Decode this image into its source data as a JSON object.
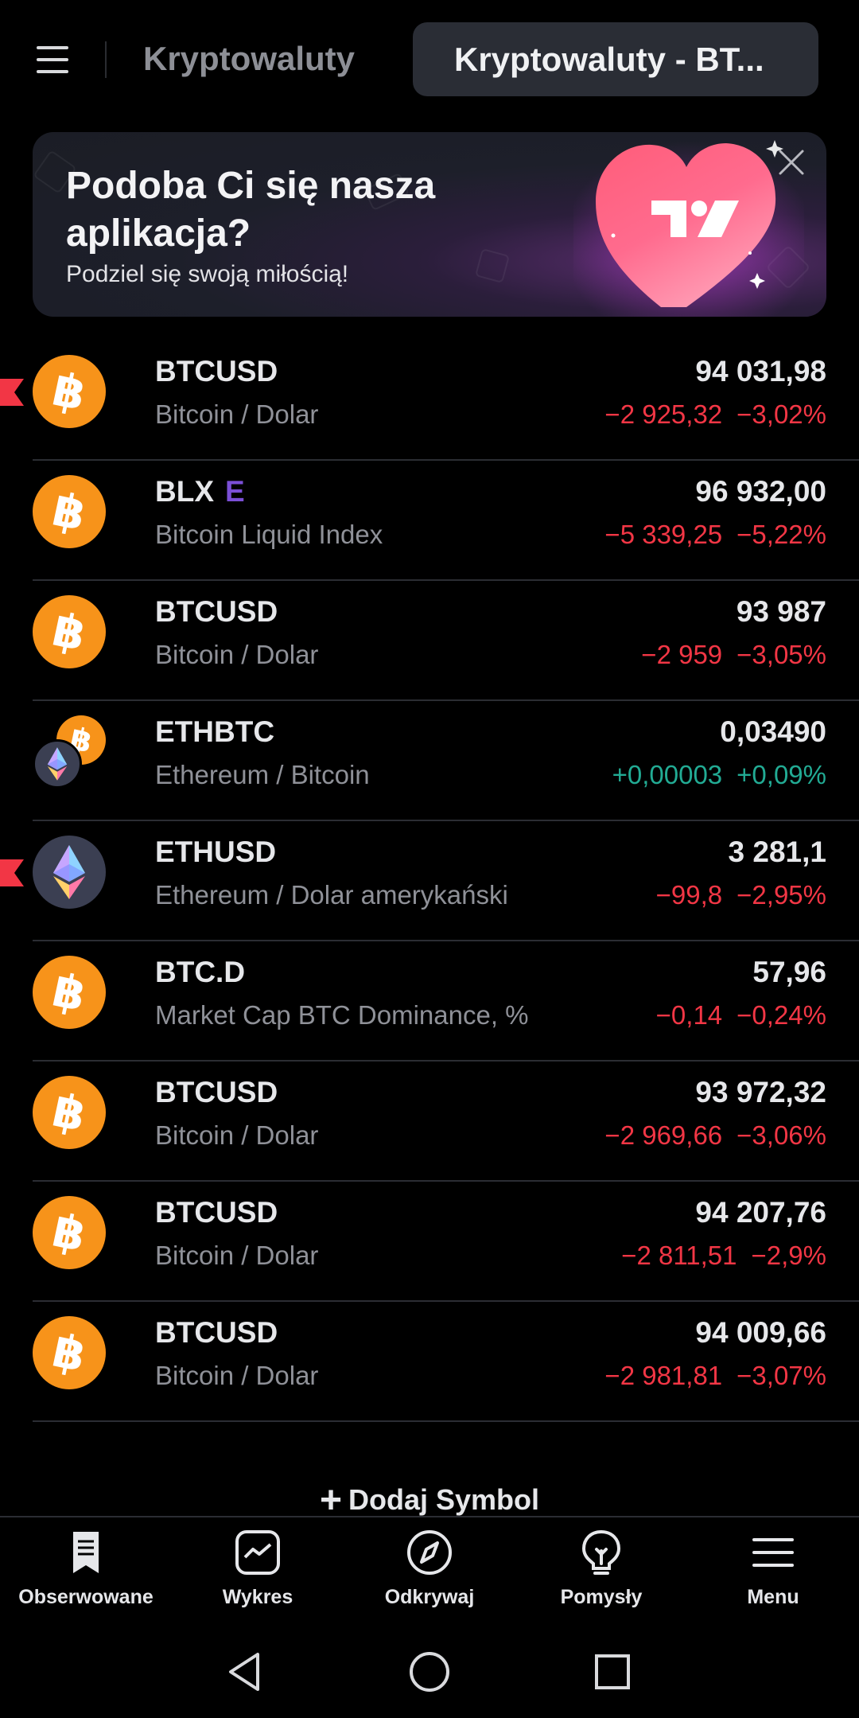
{
  "header": {
    "tab_label": "Kryptowaluty",
    "active_tab_label": "Kryptowaluty - BT..."
  },
  "banner": {
    "title": "Podoba Ci się nasza aplikacja?",
    "subtitle": "Podziel się swoją miłością!"
  },
  "rows": [
    {
      "symbol": "BTCUSD",
      "badge": "",
      "description": "Bitcoin / Dolar",
      "price": "94 031,98",
      "change": "−2 925,32",
      "change_pct": "−3,02%",
      "direction": "down",
      "icon": "bitcoin-icon",
      "flagged": true
    },
    {
      "symbol": "BLX",
      "badge": "E",
      "description": "Bitcoin Liquid Index",
      "price": "96 932,00",
      "change": "−5 339,25",
      "change_pct": "−5,22%",
      "direction": "down",
      "icon": "bitcoin-icon",
      "flagged": false
    },
    {
      "symbol": "BTCUSD",
      "badge": "",
      "description": "Bitcoin / Dolar",
      "price": "93 987",
      "change": "−2 959",
      "change_pct": "−3,05%",
      "direction": "down",
      "icon": "bitcoin-icon",
      "flagged": false
    },
    {
      "symbol": "ETHBTC",
      "badge": "",
      "description": "Ethereum / Bitcoin",
      "price": "0,03490",
      "change": "+0,00003",
      "change_pct": "+0,09%",
      "direction": "up",
      "icon": "ethereum-bitcoin-icon",
      "flagged": false
    },
    {
      "symbol": "ETHUSD",
      "badge": "",
      "description": "Ethereum / Dolar amerykański",
      "price": "3 281,1",
      "change": "−99,8",
      "change_pct": "−2,95%",
      "direction": "down",
      "icon": "ethereum-icon",
      "flagged": true
    },
    {
      "symbol": "BTC.D",
      "badge": "",
      "description": "Market Cap BTC Dominance, %",
      "price": "57,96",
      "change": "−0,14",
      "change_pct": "−0,24%",
      "direction": "down",
      "icon": "bitcoin-icon",
      "flagged": false
    },
    {
      "symbol": "BTCUSD",
      "badge": "",
      "description": "Bitcoin / Dolar",
      "price": "93 972,32",
      "change": "−2 969,66",
      "change_pct": "−3,06%",
      "direction": "down",
      "icon": "bitcoin-icon",
      "flagged": false
    },
    {
      "symbol": "BTCUSD",
      "badge": "",
      "description": "Bitcoin / Dolar",
      "price": "94 207,76",
      "change": "−2 811,51",
      "change_pct": "−2,9%",
      "direction": "down",
      "icon": "bitcoin-icon",
      "flagged": false
    },
    {
      "symbol": "BTCUSD",
      "badge": "",
      "description": "Bitcoin / Dolar",
      "price": "94 009,66",
      "change": "−2 981,81",
      "change_pct": "−3,07%",
      "direction": "down",
      "icon": "bitcoin-icon",
      "flagged": false
    }
  ],
  "add_symbol_label": "Dodaj Symbol",
  "bottom_nav": [
    {
      "label": "Obserwowane",
      "icon": "bookmark-list-icon"
    },
    {
      "label": "Wykres",
      "icon": "chart-icon"
    },
    {
      "label": "Odkrywaj",
      "icon": "compass-icon"
    },
    {
      "label": "Pomysły",
      "icon": "lightbulb-icon"
    },
    {
      "label": "Menu",
      "icon": "menu-icon"
    }
  ],
  "colors": {
    "negative": "#f23645",
    "positive": "#22ab94",
    "bitcoin": "#f7931a",
    "badge": "#7b4fd6"
  }
}
